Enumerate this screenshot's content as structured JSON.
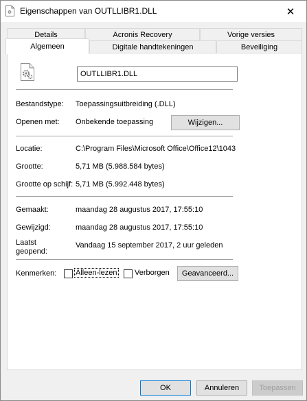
{
  "window": {
    "title": "Eigenschappen van OUTLLIBR1.DLL",
    "close_symbol": "✕"
  },
  "tabs": {
    "row1": [
      "Details",
      "Acronis Recovery",
      "Vorige versies"
    ],
    "row2": [
      "Algemeen",
      "Digitale handtekeningen",
      "Beveiliging"
    ],
    "active": "Algemeen"
  },
  "general": {
    "filename": "OUTLLIBR1.DLL",
    "file_type_label": "Bestandstype:",
    "file_type_value": "Toepassingsuitbreiding (.DLL)",
    "opens_with_label": "Openen met:",
    "opens_with_value": "Onbekende toepassing",
    "change_button": "Wijzigen...",
    "location_label": "Locatie:",
    "location_value": "C:\\Program Files\\Microsoft Office\\Office12\\1043",
    "size_label": "Grootte:",
    "size_value": "5,71 MB (5.988.584 bytes)",
    "size_on_disk_label": "Grootte op schijf:",
    "size_on_disk_value": "5,71 MB (5.992.448 bytes)",
    "created_label": "Gemaakt:",
    "created_value": "maandag 28 augustus 2017, 17:55:10",
    "modified_label": "Gewijzigd:",
    "modified_value": "maandag 28 augustus 2017, 17:55:10",
    "accessed_label_1": "Laatst",
    "accessed_label_2": "geopend:",
    "accessed_value": "Vandaag 15 september 2017, 2 uur geleden",
    "attributes_label": "Kenmerken:",
    "readonly_label": "Alleen-lezen",
    "readonly_checked": false,
    "hidden_label": "Verborgen",
    "hidden_checked": false,
    "advanced_button": "Geavanceerd..."
  },
  "footer": {
    "ok": "OK",
    "cancel": "Annuleren",
    "apply": "Toepassen"
  },
  "icons": {
    "title": "dll-file-icon",
    "file": "dll-gear-file-icon"
  }
}
